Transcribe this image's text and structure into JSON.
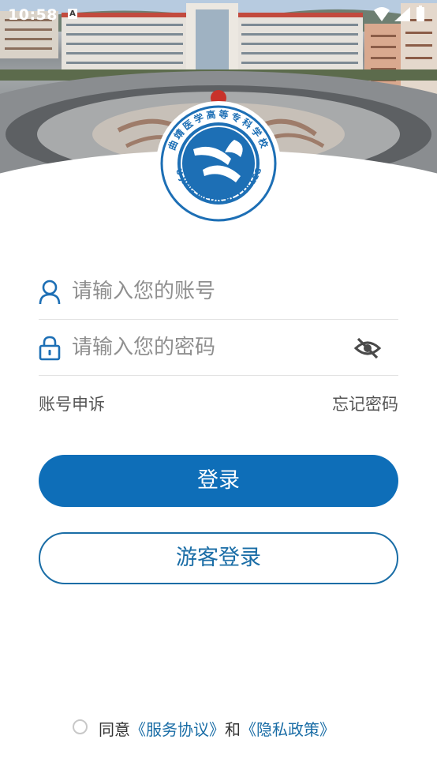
{
  "status_bar": {
    "time": "10:58",
    "notification_badge": "A",
    "icons": [
      "wifi-icon",
      "signal-icon",
      "battery-icon"
    ]
  },
  "header": {
    "image": "campus-photo",
    "logo": {
      "chinese_name": "曲靖医学高等专科学校",
      "english_name": "QU JING MEDICAL COLLEGE",
      "color": "#1d6fb5"
    }
  },
  "form": {
    "account": {
      "placeholder": "请输入您的账号",
      "value": "",
      "icon": "user-icon"
    },
    "password": {
      "placeholder": "请输入您的密码",
      "value": "",
      "icon": "lock-icon",
      "toggle_icon": "eye-off-icon"
    }
  },
  "links": {
    "appeal": "账号申诉",
    "forgot": "忘记密码"
  },
  "buttons": {
    "login": "登录",
    "guest": "游客登录"
  },
  "agreement": {
    "prefix": "同意",
    "service": "《服务协议》",
    "and": "和",
    "privacy": "《隐私政策》",
    "checked": false
  },
  "colors": {
    "primary": "#0e6eb8",
    "link": "#1a6da6",
    "icon": "#1d6fb5"
  }
}
